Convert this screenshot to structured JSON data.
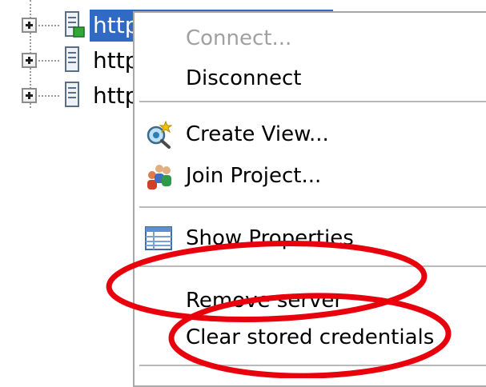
{
  "tree": {
    "items": [
      {
        "label": "http",
        "selected": true,
        "connected": true
      },
      {
        "label": "http",
        "selected": false,
        "connected": false
      },
      {
        "label": "http",
        "selected": false,
        "connected": false
      }
    ]
  },
  "context_menu": {
    "connect_label": "Connect...",
    "disconnect_label": "Disconnect",
    "create_view_label": "Create View...",
    "join_project_label": "Join Project...",
    "show_properties_label": "Show Properties",
    "remove_server_label": "Remove server",
    "clear_credentials_label": "Clear stored credentials"
  },
  "colors": {
    "selection": "#316ac5",
    "annotation": "#e8000c",
    "disabled_text": "#a0a0a0"
  },
  "icons": [
    "expand-plus-icon",
    "server-icon",
    "create-view-icon",
    "join-project-icon",
    "properties-icon"
  ]
}
